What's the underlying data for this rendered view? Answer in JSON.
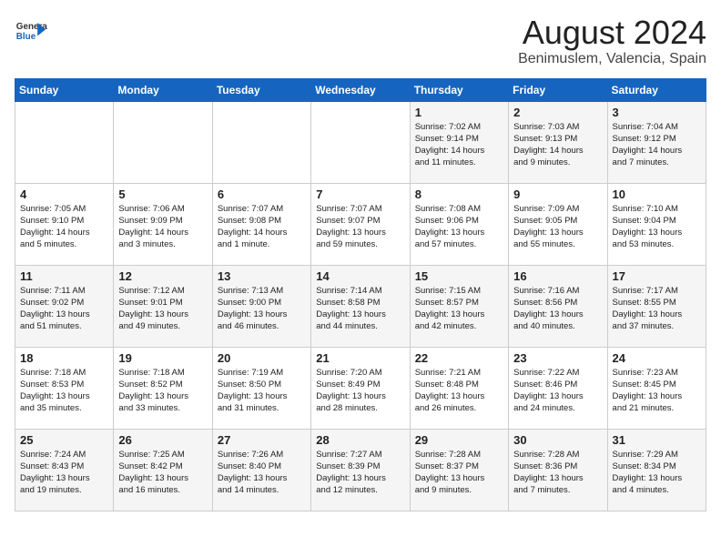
{
  "logo": {
    "general": "General",
    "blue": "Blue"
  },
  "title": {
    "month_year": "August 2024",
    "location": "Benimuslem, Valencia, Spain"
  },
  "days_of_week": [
    "Sunday",
    "Monday",
    "Tuesday",
    "Wednesday",
    "Thursday",
    "Friday",
    "Saturday"
  ],
  "weeks": [
    [
      {
        "day": "",
        "info": ""
      },
      {
        "day": "",
        "info": ""
      },
      {
        "day": "",
        "info": ""
      },
      {
        "day": "",
        "info": ""
      },
      {
        "day": "1",
        "info": "Sunrise: 7:02 AM\nSunset: 9:14 PM\nDaylight: 14 hours\nand 11 minutes."
      },
      {
        "day": "2",
        "info": "Sunrise: 7:03 AM\nSunset: 9:13 PM\nDaylight: 14 hours\nand 9 minutes."
      },
      {
        "day": "3",
        "info": "Sunrise: 7:04 AM\nSunset: 9:12 PM\nDaylight: 14 hours\nand 7 minutes."
      }
    ],
    [
      {
        "day": "4",
        "info": "Sunrise: 7:05 AM\nSunset: 9:10 PM\nDaylight: 14 hours\nand 5 minutes."
      },
      {
        "day": "5",
        "info": "Sunrise: 7:06 AM\nSunset: 9:09 PM\nDaylight: 14 hours\nand 3 minutes."
      },
      {
        "day": "6",
        "info": "Sunrise: 7:07 AM\nSunset: 9:08 PM\nDaylight: 14 hours\nand 1 minute."
      },
      {
        "day": "7",
        "info": "Sunrise: 7:07 AM\nSunset: 9:07 PM\nDaylight: 13 hours\nand 59 minutes."
      },
      {
        "day": "8",
        "info": "Sunrise: 7:08 AM\nSunset: 9:06 PM\nDaylight: 13 hours\nand 57 minutes."
      },
      {
        "day": "9",
        "info": "Sunrise: 7:09 AM\nSunset: 9:05 PM\nDaylight: 13 hours\nand 55 minutes."
      },
      {
        "day": "10",
        "info": "Sunrise: 7:10 AM\nSunset: 9:04 PM\nDaylight: 13 hours\nand 53 minutes."
      }
    ],
    [
      {
        "day": "11",
        "info": "Sunrise: 7:11 AM\nSunset: 9:02 PM\nDaylight: 13 hours\nand 51 minutes."
      },
      {
        "day": "12",
        "info": "Sunrise: 7:12 AM\nSunset: 9:01 PM\nDaylight: 13 hours\nand 49 minutes."
      },
      {
        "day": "13",
        "info": "Sunrise: 7:13 AM\nSunset: 9:00 PM\nDaylight: 13 hours\nand 46 minutes."
      },
      {
        "day": "14",
        "info": "Sunrise: 7:14 AM\nSunset: 8:58 PM\nDaylight: 13 hours\nand 44 minutes."
      },
      {
        "day": "15",
        "info": "Sunrise: 7:15 AM\nSunset: 8:57 PM\nDaylight: 13 hours\nand 42 minutes."
      },
      {
        "day": "16",
        "info": "Sunrise: 7:16 AM\nSunset: 8:56 PM\nDaylight: 13 hours\nand 40 minutes."
      },
      {
        "day": "17",
        "info": "Sunrise: 7:17 AM\nSunset: 8:55 PM\nDaylight: 13 hours\nand 37 minutes."
      }
    ],
    [
      {
        "day": "18",
        "info": "Sunrise: 7:18 AM\nSunset: 8:53 PM\nDaylight: 13 hours\nand 35 minutes."
      },
      {
        "day": "19",
        "info": "Sunrise: 7:18 AM\nSunset: 8:52 PM\nDaylight: 13 hours\nand 33 minutes."
      },
      {
        "day": "20",
        "info": "Sunrise: 7:19 AM\nSunset: 8:50 PM\nDaylight: 13 hours\nand 31 minutes."
      },
      {
        "day": "21",
        "info": "Sunrise: 7:20 AM\nSunset: 8:49 PM\nDaylight: 13 hours\nand 28 minutes."
      },
      {
        "day": "22",
        "info": "Sunrise: 7:21 AM\nSunset: 8:48 PM\nDaylight: 13 hours\nand 26 minutes."
      },
      {
        "day": "23",
        "info": "Sunrise: 7:22 AM\nSunset: 8:46 PM\nDaylight: 13 hours\nand 24 minutes."
      },
      {
        "day": "24",
        "info": "Sunrise: 7:23 AM\nSunset: 8:45 PM\nDaylight: 13 hours\nand 21 minutes."
      }
    ],
    [
      {
        "day": "25",
        "info": "Sunrise: 7:24 AM\nSunset: 8:43 PM\nDaylight: 13 hours\nand 19 minutes."
      },
      {
        "day": "26",
        "info": "Sunrise: 7:25 AM\nSunset: 8:42 PM\nDaylight: 13 hours\nand 16 minutes."
      },
      {
        "day": "27",
        "info": "Sunrise: 7:26 AM\nSunset: 8:40 PM\nDaylight: 13 hours\nand 14 minutes."
      },
      {
        "day": "28",
        "info": "Sunrise: 7:27 AM\nSunset: 8:39 PM\nDaylight: 13 hours\nand 12 minutes."
      },
      {
        "day": "29",
        "info": "Sunrise: 7:28 AM\nSunset: 8:37 PM\nDaylight: 13 hours\nand 9 minutes."
      },
      {
        "day": "30",
        "info": "Sunrise: 7:28 AM\nSunset: 8:36 PM\nDaylight: 13 hours\nand 7 minutes."
      },
      {
        "day": "31",
        "info": "Sunrise: 7:29 AM\nSunset: 8:34 PM\nDaylight: 13 hours\nand 4 minutes."
      }
    ]
  ]
}
